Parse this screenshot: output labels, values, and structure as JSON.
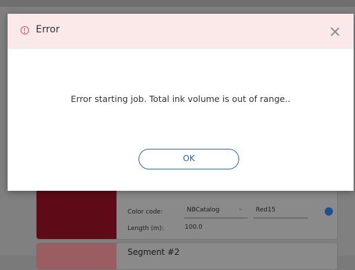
{
  "dialog": {
    "title": "Error",
    "message": "Error starting job. Total ink volume is out of range..",
    "ok_label": "OK"
  },
  "background": {
    "segment1": {
      "color_code_label": "Color code:",
      "color_code_value": "NBCatalog",
      "color_name_value": "Red15",
      "length_label": "Length (m):",
      "length_value": "100.0"
    },
    "segment2": {
      "title": "Segment #2"
    }
  }
}
